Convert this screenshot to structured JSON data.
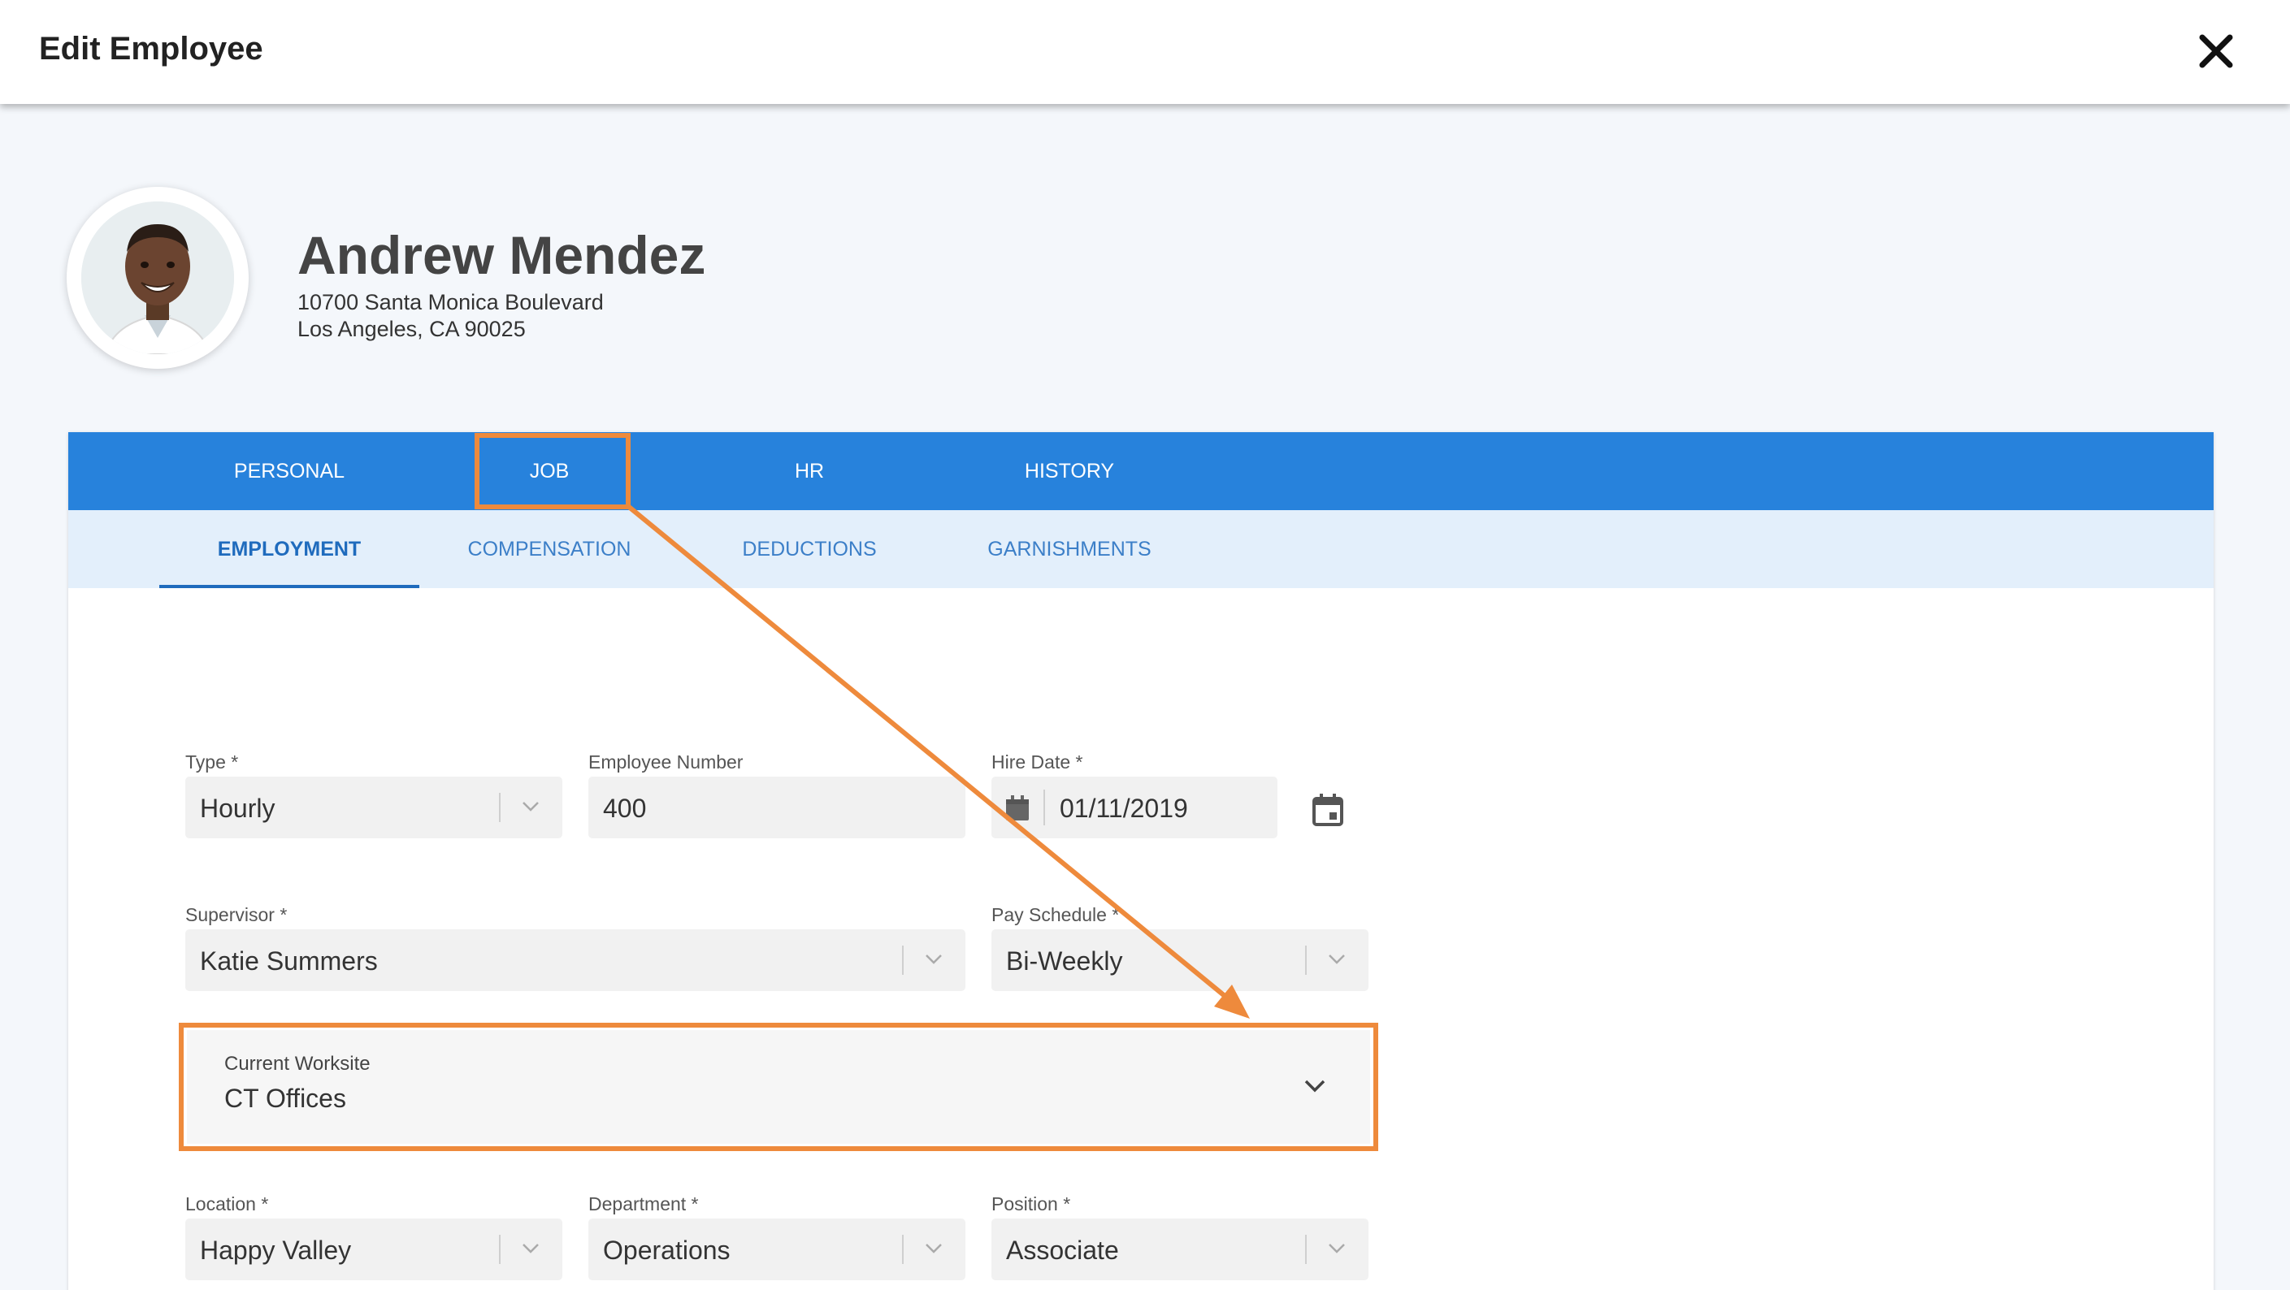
{
  "dialog": {
    "title": "Edit Employee",
    "close_icon": "close-icon"
  },
  "employee": {
    "name": "Andrew Mendez",
    "address_line1": "10700 Santa Monica Boulevard",
    "address_line2": "Los Angeles, CA 90025",
    "avatar_icon": "avatar-photo"
  },
  "tabs": [
    {
      "label": "PERSONAL"
    },
    {
      "label": "JOB",
      "active": true
    },
    {
      "label": "HR"
    },
    {
      "label": "HISTORY"
    }
  ],
  "subtabs": [
    {
      "label": "EMPLOYMENT",
      "active": true
    },
    {
      "label": "COMPENSATION"
    },
    {
      "label": "DEDUCTIONS"
    },
    {
      "label": "GARNISHMENTS"
    }
  ],
  "form": {
    "type": {
      "label": "Type *",
      "value": "Hourly"
    },
    "employee_number": {
      "label": "Employee Number",
      "value": "400"
    },
    "hire_date": {
      "label": "Hire Date *",
      "value": "01/11/2019"
    },
    "supervisor": {
      "label": "Supervisor *",
      "value": "Katie Summers"
    },
    "pay_schedule": {
      "label": "Pay Schedule *",
      "value": "Bi-Weekly"
    },
    "current_worksite": {
      "label": "Current Worksite",
      "value": "CT Offices"
    },
    "location": {
      "label": "Location *",
      "value": "Happy Valley"
    },
    "department": {
      "label": "Department *",
      "value": "Operations"
    },
    "position": {
      "label": "Position *",
      "value": "Associate"
    }
  },
  "colors": {
    "tab_bar": "#2782dc",
    "subtab_bar": "#e3effb",
    "highlight": "#ee8a3c",
    "active_subtab": "#1f6bbd"
  }
}
